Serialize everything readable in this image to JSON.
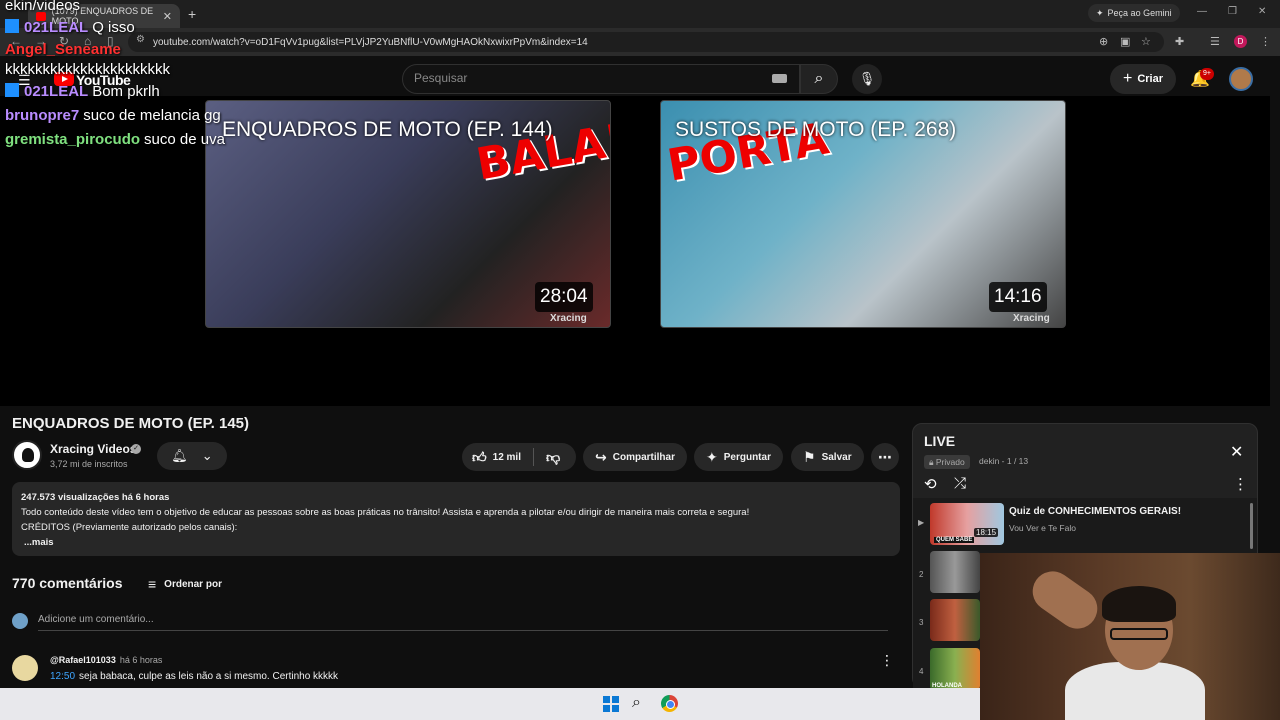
{
  "browser": {
    "tab_title": "(1079) ENQUADROS DE MOTO",
    "gemini_label": "Peça ao Gemini",
    "url": "youtube.com/watch?v=oD1FqVv1pug&list=PLVjJP2YuBNflU-V0wMgHAOkNxwixrPpVm&index=14",
    "profile_initial": "D"
  },
  "youtube_header": {
    "logo_text": "YouTube",
    "search_placeholder": "Pesquisar",
    "create_label": "Criar",
    "notifications_badge": "9+"
  },
  "chat": [
    {
      "user": "",
      "message": "ekin/videos",
      "color": "#ffffff",
      "badge": false
    },
    {
      "user": "021LEAL",
      "message": "Q isso",
      "color": "#b98cff",
      "badge": true
    },
    {
      "user": "Angel_Seneame",
      "message": "",
      "color": "#ff3030",
      "badge": true
    },
    {
      "user": "",
      "message": "kkkkkkkkkkkkkkkkkkkkkk",
      "color": "#ffffff",
      "badge": false
    },
    {
      "user": "021LEAL",
      "message": "Bom pkrlh",
      "color": "#b98cff",
      "badge": true
    },
    {
      "user": "brunopre7",
      "message": "suco de melancia gg",
      "color": "#b98cff",
      "badge": false
    },
    {
      "user": "gremista_pirocudo",
      "message": "suco de uva",
      "color": "#7fe07f",
      "badge": false
    }
  ],
  "endscreen": {
    "videos": [
      {
        "title": "ENQUADROS DE MOTO (EP. 144)",
        "overlay": "BALA!",
        "duration": "28:04",
        "watermark": "Xracing"
      },
      {
        "title": "SUSTOS DE MOTO (EP. 268)",
        "overlay": "PORTA",
        "duration": "14:16",
        "watermark": "Xracing"
      }
    ]
  },
  "video": {
    "title": "ENQUADROS DE MOTO (EP. 145)",
    "channel_name": "Xracing Videos",
    "subscribers": "3,72 mi de inscritos",
    "likes": "12 mil",
    "share_label": "Compartilhar",
    "ask_label": "Perguntar",
    "save_label": "Salvar",
    "views_line": "247.573 visualizações  há 6 horas",
    "description_line1": "Todo conteúdo deste vídeo tem o objetivo de educar as pessoas sobre as boas práticas no trânsito! Assista e aprenda a pilotar e/ou dirigir de maneira mais correta e segura!",
    "description_line2": "CRÉDITOS (Previamente autorizado pelos canais):",
    "more_label": "...mais"
  },
  "comments": {
    "count_label": "770 comentários",
    "sort_label": "Ordenar por",
    "add_placeholder": "Adicione um comentário...",
    "items": [
      {
        "user": "@Rafael101033",
        "time": "há 6 horas",
        "timestamp": "12:50",
        "text": "seja babaca, culpe as leis não a si mesmo. Certinho kkkkk"
      }
    ]
  },
  "playlist": {
    "title": "LIVE",
    "privacy": "Privado",
    "owner_position": "dekin - 1 / 13",
    "items": [
      {
        "num": "",
        "title": "Quiz de CONHECIMENTOS GERAIS!",
        "channel": "Vou Ver e Te Falo",
        "duration": "18:15",
        "thumb_label": "QUEM SABE"
      },
      {
        "num": "2"
      },
      {
        "num": "3"
      },
      {
        "num": "4",
        "thumb_label": "HOLANDA"
      }
    ]
  },
  "colors": {
    "background": "#0f0f0f",
    "accent_red": "#ff0000",
    "link_blue": "#3ea6ff"
  }
}
